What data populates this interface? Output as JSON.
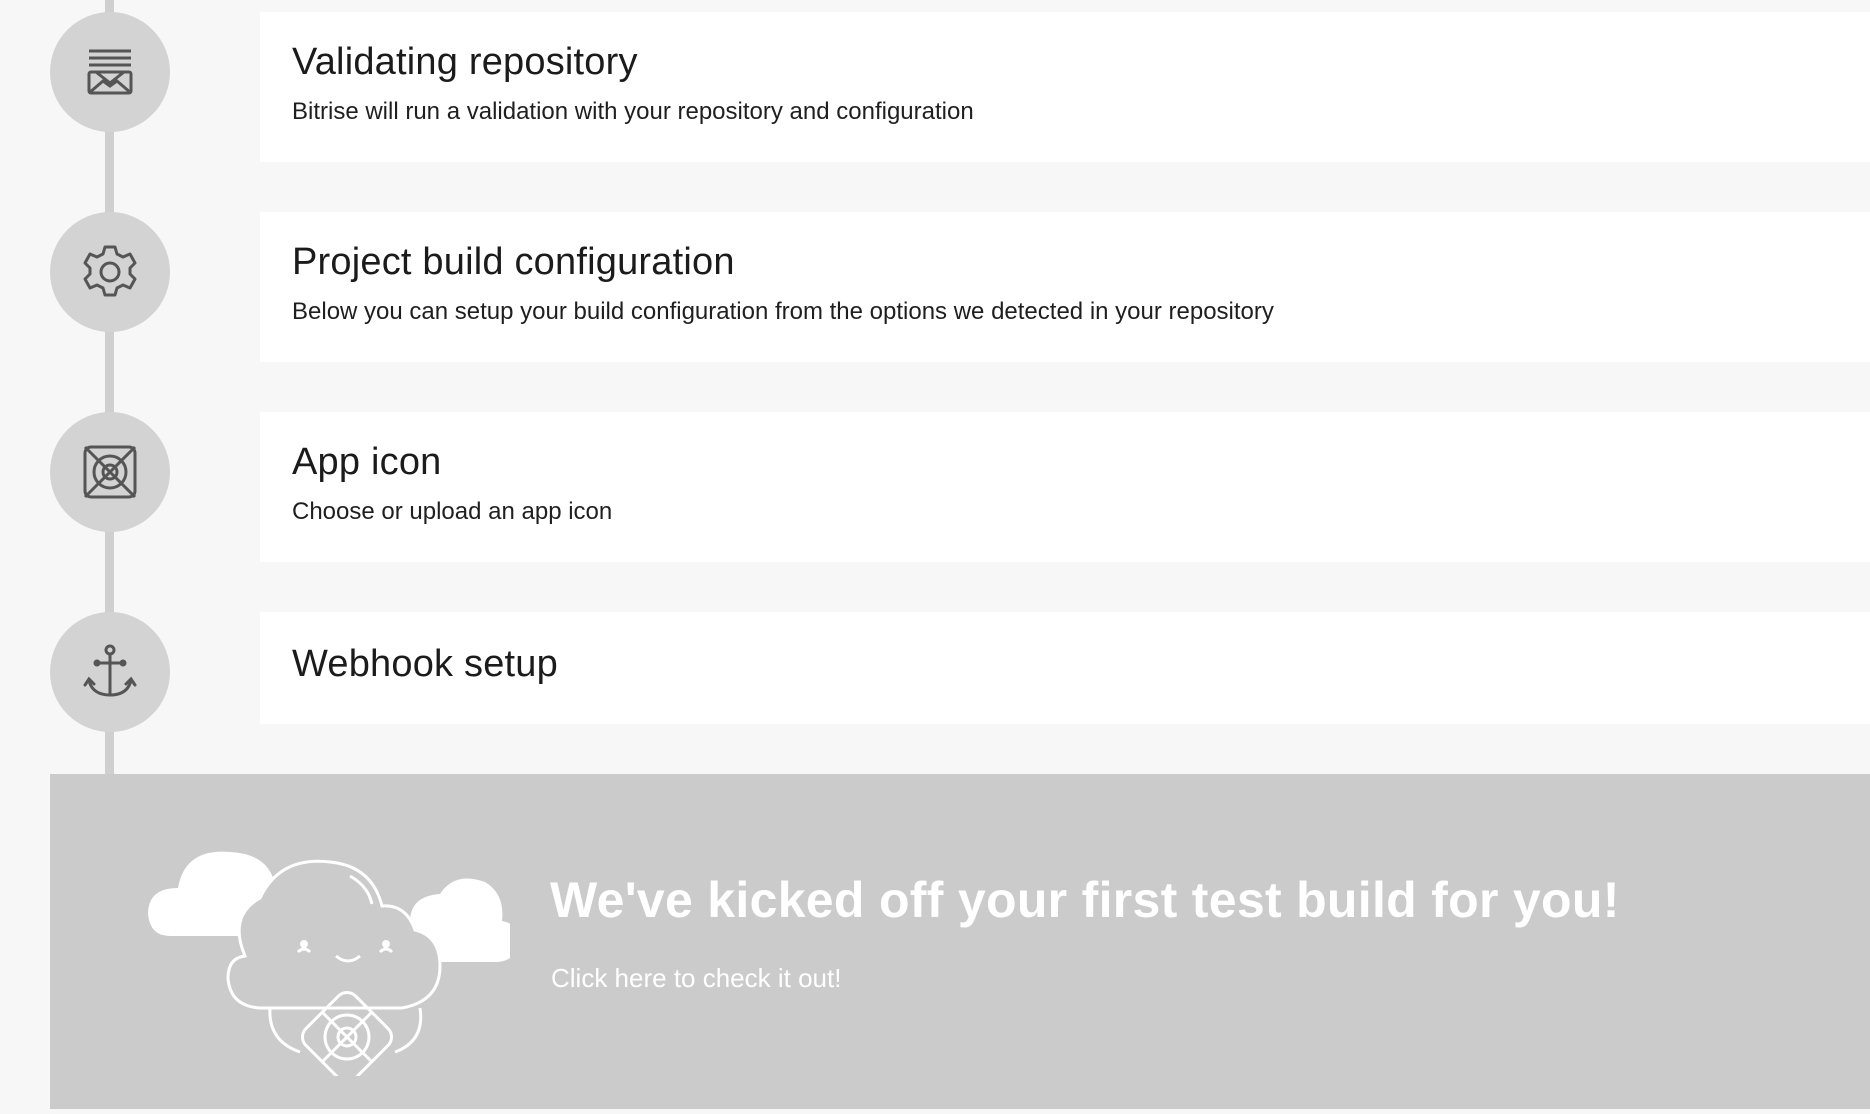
{
  "steps": [
    {
      "title": "Validating repository",
      "description": "Bitrise will run a validation with your repository and configuration",
      "icon": "repository-icon"
    },
    {
      "title": "Project build configuration",
      "description": "Below you can setup your build configuration from the options we detected in your repository",
      "icon": "gear-icon"
    },
    {
      "title": "App icon",
      "description": "Choose or upload an app icon",
      "icon": "app-icon-icon"
    },
    {
      "title": "Webhook setup",
      "description": "",
      "icon": "anchor-icon"
    }
  ],
  "banner": {
    "title": "We've kicked off your first test build for you!",
    "link_label": "Click here to check it out!"
  },
  "colors": {
    "background": "#f7f7f7",
    "card": "#ffffff",
    "circle": "#d3d3d3",
    "icon_stroke": "#555555",
    "banner": "#cbcbcb",
    "banner_text": "#ffffff"
  }
}
